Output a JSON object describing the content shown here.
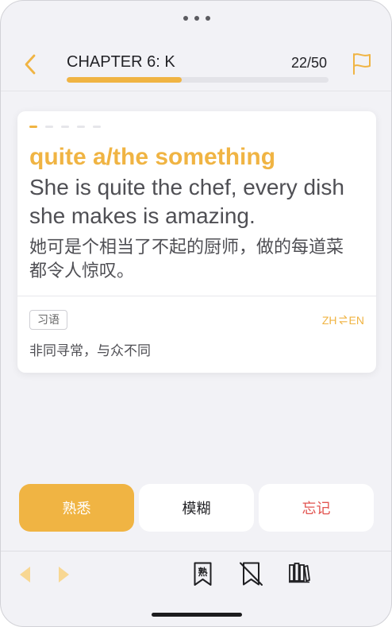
{
  "window": {
    "menu_icon": "more-dots-icon"
  },
  "header": {
    "back_icon": "chevron-left-icon",
    "chapter_title": "CHAPTER 6: K",
    "progress_label": "22/50",
    "progress": {
      "current": 22,
      "total": 50
    },
    "flag_icon": "flag-icon"
  },
  "card": {
    "steps": {
      "total": 5,
      "current": 1
    },
    "phrase": "quite a/the something",
    "example_en": "She is quite the chef, every dish she makes is amazing.",
    "example_zh": "她可是个相当了不起的厨师，做的每道菜都令人惊叹。",
    "tag": "习语",
    "language_toggle": {
      "from": "ZH",
      "to": "EN",
      "icon": "swap-arrows-icon"
    },
    "meaning": "非同寻常，与众不同"
  },
  "actions": [
    {
      "label": "熟悉",
      "background": "#f0b443",
      "text_color": "#ffffff"
    },
    {
      "label": "模糊",
      "background": "#ffffff",
      "text_color": "#222226"
    },
    {
      "label": "忘记",
      "background": "#ffffff",
      "text_color": "#e25450"
    }
  ],
  "toolbar": {
    "prev_icon": "triangle-left-icon",
    "next_icon": "triangle-right-icon",
    "mark_familiar": {
      "icon": "bookmark-familiar-icon",
      "label": "熟"
    },
    "unbookmark_icon": "bookmark-off-icon",
    "library_icon": "library-icon"
  },
  "colors": {
    "accent": "#f0b443",
    "background": "#f2f2f6",
    "card": "#ffffff",
    "nav_arrow": "#f8d792",
    "danger": "#e25450"
  }
}
